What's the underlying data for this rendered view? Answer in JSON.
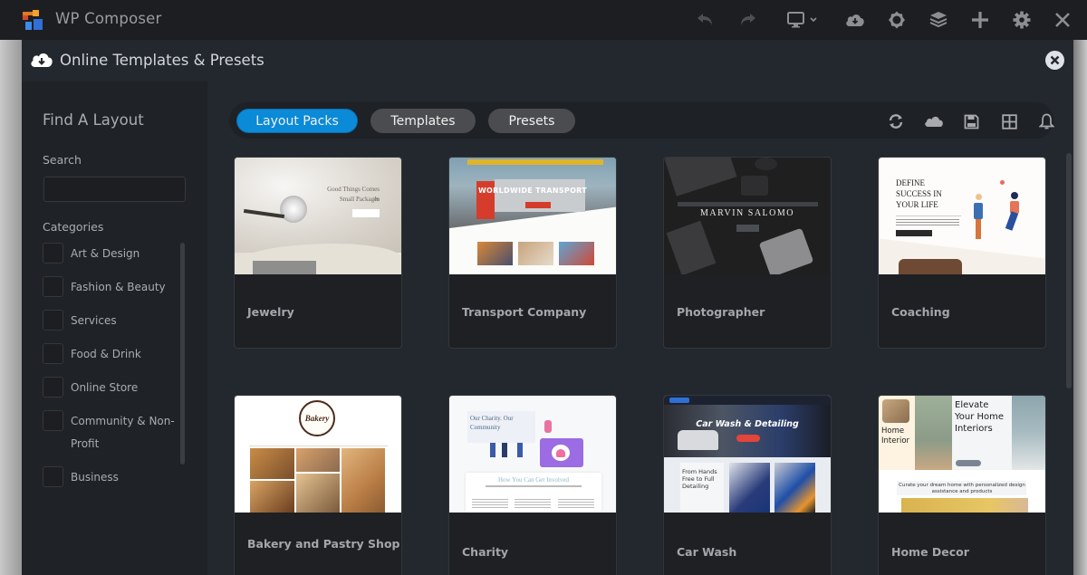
{
  "app": {
    "title": "WP Composer",
    "toolbar_icons": [
      "undo-icon",
      "redo-icon",
      "desktop-icon",
      "cloud-download-icon",
      "brightness-icon",
      "layers-icon",
      "plus-icon",
      "gear-icon",
      "close-icon"
    ]
  },
  "modal": {
    "title": "Online Templates & Presets"
  },
  "sidebar": {
    "title": "Find A Layout",
    "search_label": "Search",
    "search_value": "",
    "search_placeholder": "",
    "categories_label": "Categories",
    "categories": [
      {
        "label": "Art & Design",
        "checked": false
      },
      {
        "label": "Fashion & Beauty",
        "checked": false
      },
      {
        "label": "Services",
        "checked": false
      },
      {
        "label": "Food & Drink",
        "checked": false
      },
      {
        "label": "Online Store",
        "checked": false
      },
      {
        "label": "Community & Non-Profit",
        "checked": false
      },
      {
        "label": "Business",
        "checked": false
      }
    ]
  },
  "tabs": [
    {
      "label": "Layout Packs",
      "active": true
    },
    {
      "label": "Templates",
      "active": false
    },
    {
      "label": "Presets",
      "active": false
    }
  ],
  "tab_actions": [
    "refresh-icon",
    "cloud-icon",
    "save-icon",
    "grid-icon",
    "bell-icon"
  ],
  "cards": [
    {
      "label": "Jewelry",
      "thumb_text": [
        "Good Things Comes In",
        "Small Packages"
      ]
    },
    {
      "label": "Transport Company",
      "thumb_text": [
        "WORLDWIDE TRANSPORT"
      ]
    },
    {
      "label": "Photographer",
      "thumb_text": [
        "MARVIN SALOMO"
      ]
    },
    {
      "label": "Coaching",
      "thumb_text": [
        "DEFINE",
        "SUCCESS IN",
        "YOUR LIFE"
      ]
    },
    {
      "label": "Bakery and Pastry Shop",
      "thumb_text": [
        "Bakery"
      ]
    },
    {
      "label": "Charity",
      "thumb_text": [
        "Our Charity. Our Community",
        "How You Can Get Involved"
      ]
    },
    {
      "label": "Car Wash",
      "thumb_text": [
        "Car Wash & Detailing",
        "From Hands Free to Full Detailing"
      ]
    },
    {
      "label": "Home Decor",
      "thumb_text": [
        "Home Interior",
        "Elevate Your Home Interiors",
        "Curate your dream home with personalized design assistance and products"
      ]
    }
  ],
  "colors": {
    "accent": "#0b8ad7",
    "topbar": "#1d1e21",
    "modal_bg": "#23272e",
    "sidebar_bg": "#1f2226"
  }
}
